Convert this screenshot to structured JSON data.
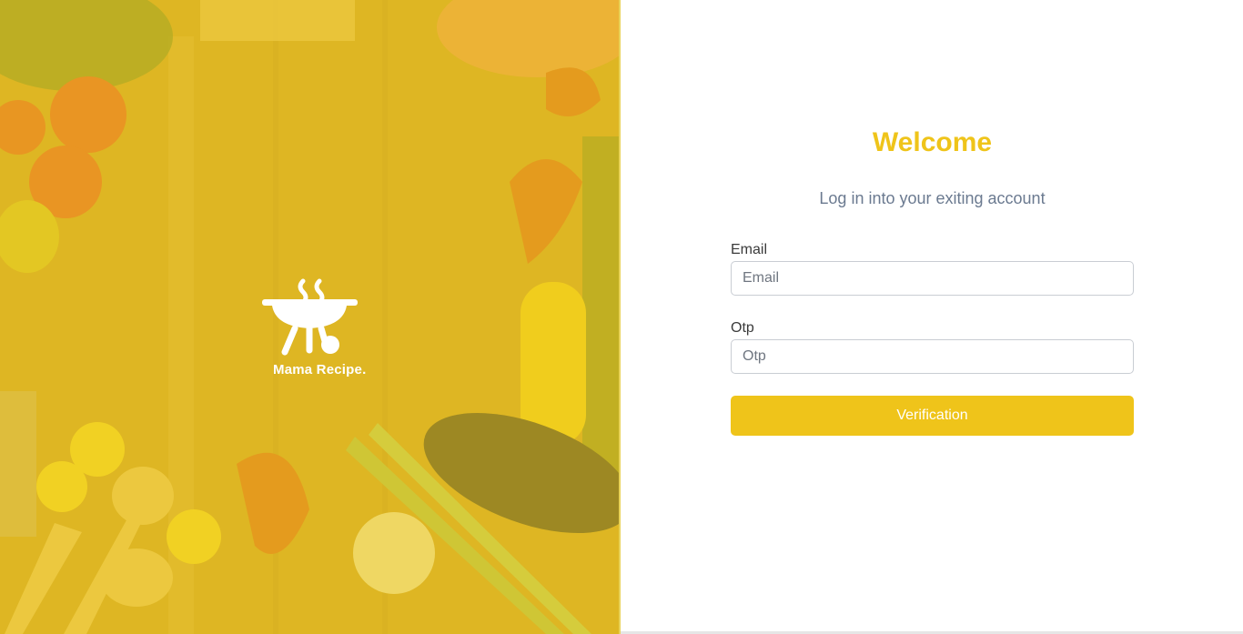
{
  "brand": {
    "name": "Mama Recipe."
  },
  "login": {
    "title": "Welcome",
    "subtitle": "Log in into your exiting account",
    "email": {
      "label": "Email",
      "placeholder": "Email",
      "value": ""
    },
    "otp": {
      "label": "Otp",
      "placeholder": "Otp",
      "value": ""
    },
    "submit_label": "Verification"
  },
  "colors": {
    "accent": "#efc41a",
    "subtitle": "#6b7a90",
    "hero_overlay": "#eec81e"
  }
}
